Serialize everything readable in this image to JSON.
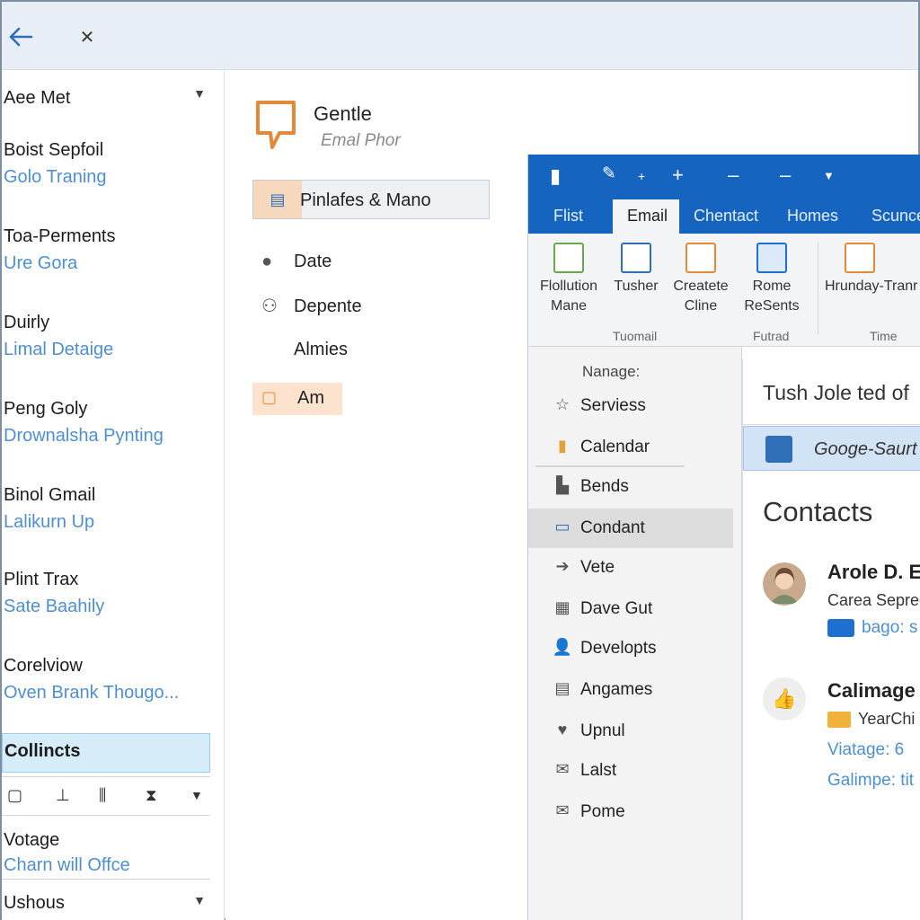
{
  "topbar": {
    "back_icon": "arrow-left-icon",
    "close_icon": "close-icon"
  },
  "left_list": {
    "header": "Aee Met",
    "items": [
      {
        "title": "Boist Sepfoil",
        "subtitle": "Golo Traning"
      },
      {
        "title": "Toa-Perments",
        "subtitle": "Ure Gora"
      },
      {
        "title": "Duirly",
        "subtitle": "Limal Detaige"
      },
      {
        "title": "Peng Goly",
        "subtitle": "Drownalsha Pynting"
      },
      {
        "title": "Binol Gmail",
        "subtitle": "Lalikurn Up"
      },
      {
        "title": "Plint Trax",
        "subtitle": "Sate Baahily"
      },
      {
        "title": "Corelviow",
        "subtitle": "Oven Brank Thougo..."
      }
    ],
    "selected": "Collincts",
    "footer_items": [
      {
        "title": "Votage",
        "subtitle": "Charn will Offce"
      },
      {
        "title": "Ushous"
      }
    ]
  },
  "middle": {
    "title": "Gentle",
    "subtitle": "Emal Phor",
    "button": "Pinlafes & Mano",
    "rows": [
      "Date",
      "Depente",
      "Almies"
    ],
    "highlight": "Am"
  },
  "outlook": {
    "tabs": [
      "Flist",
      "Email",
      "Chentact",
      "Homes",
      "Scuncer"
    ],
    "active_tab": "Email",
    "ribbon_buttons": [
      {
        "line1": "Flollution",
        "line2": "Mane"
      },
      {
        "line1": "Tusher",
        "line2": ""
      },
      {
        "line1": "Createte",
        "line2": "Cline"
      },
      {
        "line1": "Rome",
        "line2": "ReSents"
      },
      {
        "line1": "Hrunday-Tranr",
        "line2": ""
      }
    ],
    "ribbon_groups": [
      "Tuomail",
      "Futrad",
      "Time"
    ],
    "nav": {
      "title": "Nanage:",
      "items": [
        {
          "label": "Serviess",
          "icon": "star-icon"
        },
        {
          "label": "Calendar",
          "icon": "calendar-icon"
        },
        {
          "label": "Bends",
          "icon": "building-icon"
        },
        {
          "label": "Condant",
          "icon": "contact-card-icon"
        },
        {
          "label": "Vete",
          "icon": "arrow-right-icon"
        },
        {
          "label": "Dave Gut",
          "icon": "grid-icon"
        },
        {
          "label": "Developts",
          "icon": "person-icon"
        },
        {
          "label": "Angames",
          "icon": "clipboard-icon"
        },
        {
          "label": "Upnul",
          "icon": "heart-icon"
        },
        {
          "label": "Lalst",
          "icon": "mail-icon"
        },
        {
          "label": "Pome",
          "icon": "envelope-icon"
        }
      ],
      "active": "Condant"
    },
    "contacts_pane": {
      "search_text": "Tush Jole ted of",
      "google_row": "Googe-Saurt",
      "title": "Contacts",
      "cards": [
        {
          "name": "Arole D. E",
          "line": "Carea Seprec",
          "link": "bago: s"
        },
        {
          "name": "Calimage",
          "line": "YearChi",
          "link1": "Viatage: 6",
          "link2": "Galimpe: tit"
        }
      ]
    }
  },
  "colors": {
    "accent": "#1565c0",
    "link": "#4f8fd0",
    "selection": "#d6ecf9",
    "highlight": "#fde3cd"
  }
}
